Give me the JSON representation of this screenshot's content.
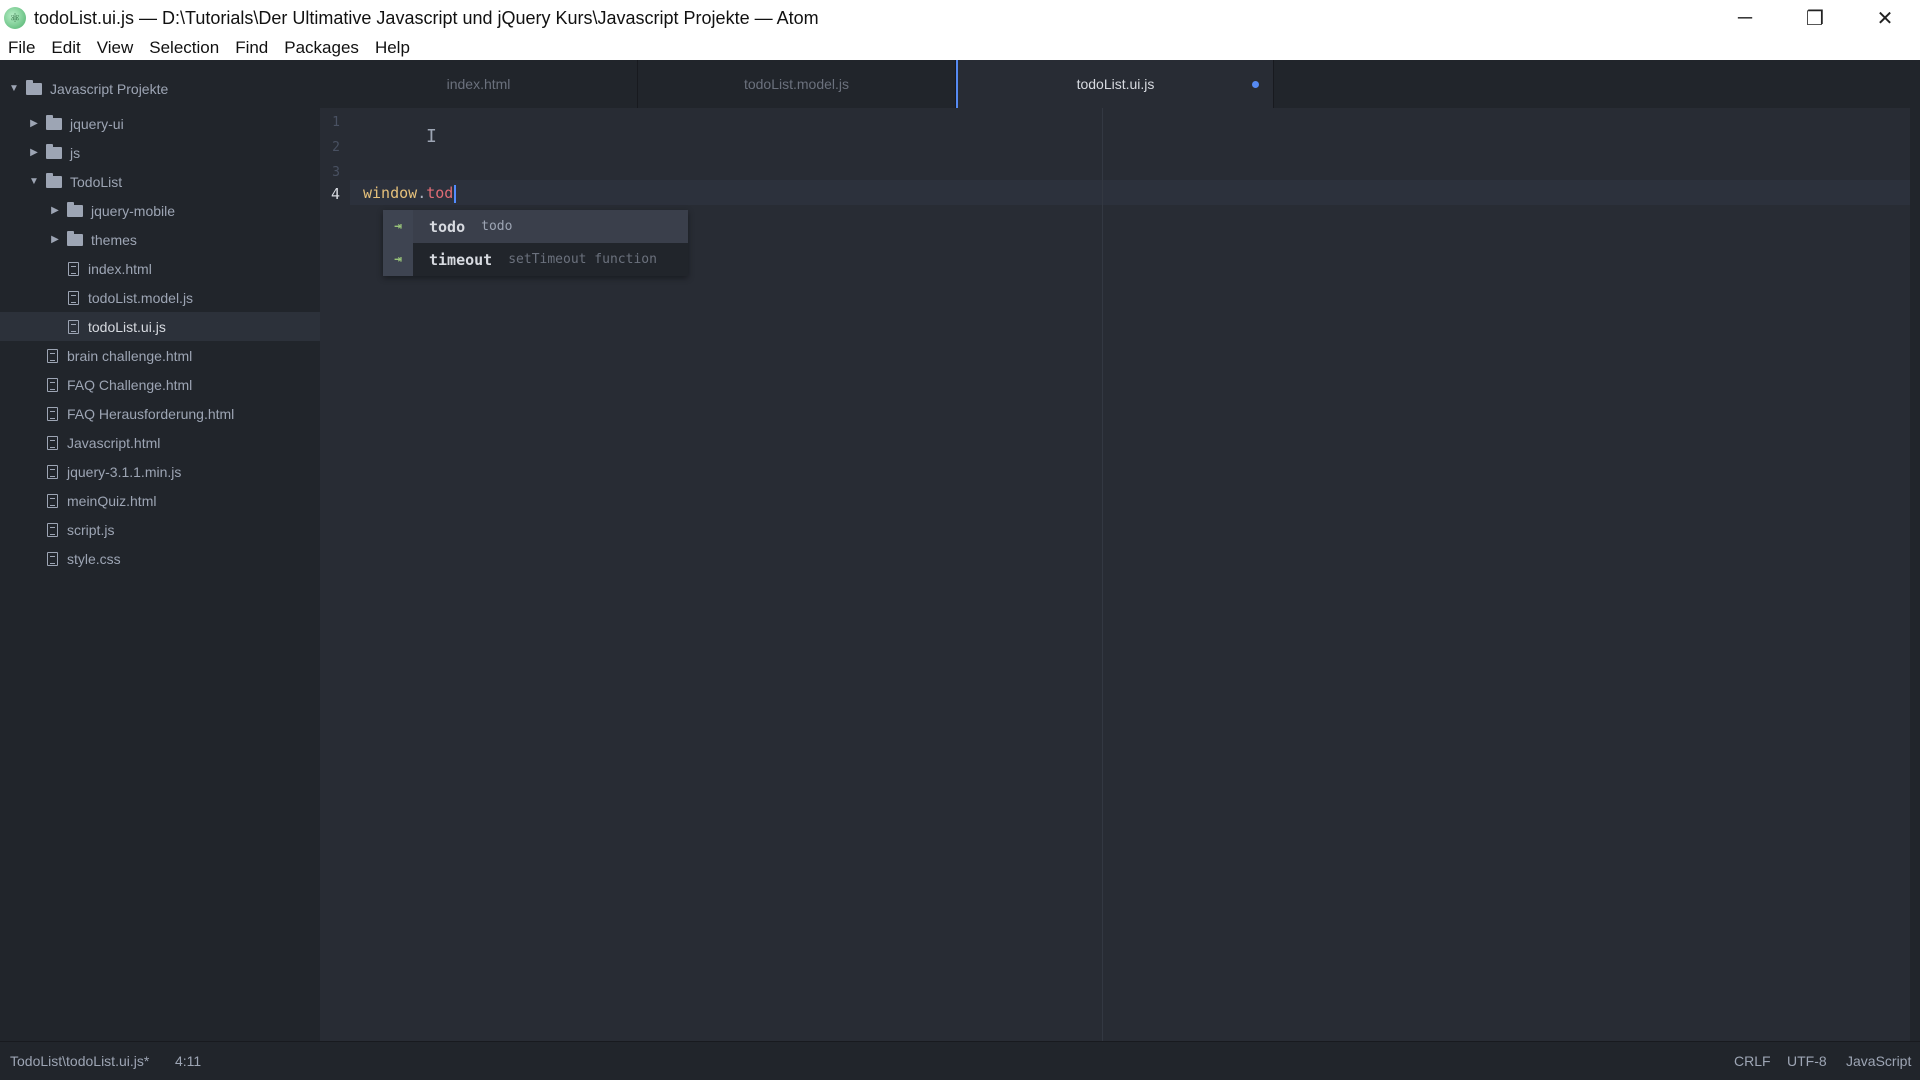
{
  "window": {
    "title": "todoList.ui.js — D:\\Tutorials\\Der Ultimative Javascript und jQuery Kurs\\Javascript Projekte — Atom",
    "controls": {
      "minimize": "─",
      "maximize": "❐",
      "close": "✕"
    }
  },
  "menu": [
    "File",
    "Edit",
    "View",
    "Selection",
    "Find",
    "Packages",
    "Help"
  ],
  "tree": {
    "root": "Javascript Projekte",
    "items": [
      {
        "label": "jquery-ui",
        "kind": "folder",
        "expanded": false,
        "depth": 1
      },
      {
        "label": "js",
        "kind": "folder",
        "expanded": false,
        "depth": 1
      },
      {
        "label": "TodoList",
        "kind": "folder",
        "expanded": true,
        "depth": 1
      },
      {
        "label": "jquery-mobile",
        "kind": "folder",
        "expanded": false,
        "depth": 2
      },
      {
        "label": "themes",
        "kind": "folder",
        "expanded": false,
        "depth": 2
      },
      {
        "label": "index.html",
        "kind": "file",
        "depth": 2
      },
      {
        "label": "todoList.model.js",
        "kind": "file",
        "depth": 2
      },
      {
        "label": "todoList.ui.js",
        "kind": "file",
        "depth": 2,
        "selected": true
      },
      {
        "label": "brain challenge.html",
        "kind": "file",
        "depth": 1
      },
      {
        "label": "FAQ Challenge.html",
        "kind": "file",
        "depth": 1
      },
      {
        "label": "FAQ Herausforderung.html",
        "kind": "file",
        "depth": 1
      },
      {
        "label": "Javascript.html",
        "kind": "file",
        "depth": 1
      },
      {
        "label": "jquery-3.1.1.min.js",
        "kind": "file",
        "depth": 1
      },
      {
        "label": "meinQuiz.html",
        "kind": "file",
        "depth": 1
      },
      {
        "label": "script.js",
        "kind": "file",
        "depth": 1
      },
      {
        "label": "style.css",
        "kind": "file",
        "depth": 1
      }
    ]
  },
  "tabs": [
    {
      "label": "index.html",
      "active": false,
      "modified": false
    },
    {
      "label": "todoList.model.js",
      "active": false,
      "modified": false
    },
    {
      "label": "todoList.ui.js",
      "active": true,
      "modified": true
    }
  ],
  "editor": {
    "line_numbers": [
      "1",
      "2",
      "3",
      "4"
    ],
    "current_line": "4",
    "code": {
      "object": "window",
      "dot": ".",
      "property": "tod"
    },
    "cursor_glyph": "I"
  },
  "autocomplete": [
    {
      "type_icon": "⇥",
      "word": "todo",
      "desc": "todo",
      "selected": true
    },
    {
      "type_icon": "⇥",
      "word": "timeout",
      "desc": "setTimeout function",
      "selected": false
    }
  ],
  "statusbar": {
    "file_path": "TodoList\\todoList.ui.js*",
    "cursor_position": "4:11",
    "line_ending": "CRLF",
    "encoding": "UTF-8",
    "grammar": "JavaScript"
  },
  "colors": {
    "accent": "#568af2",
    "editor_bg": "#282c34",
    "panel_bg": "#21252b"
  }
}
